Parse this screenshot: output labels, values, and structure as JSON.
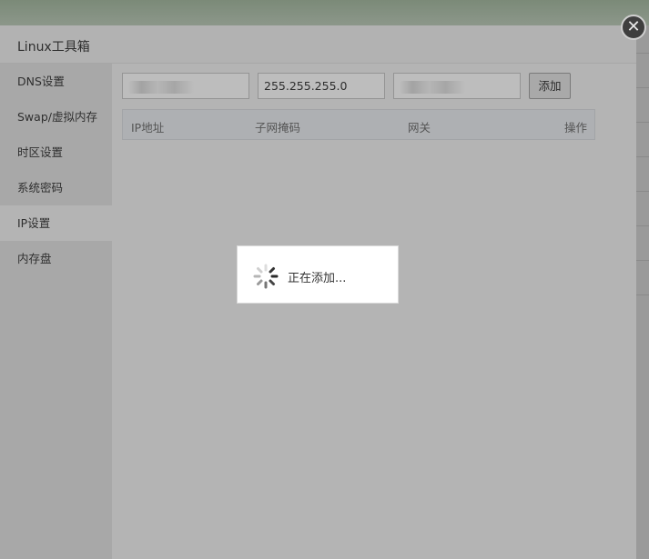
{
  "dialog": {
    "title": "Linux工具箱"
  },
  "sidebar": {
    "items": [
      {
        "label": "DNS设置"
      },
      {
        "label": "Swap/虚拟内存"
      },
      {
        "label": "时区设置"
      },
      {
        "label": "系统密码"
      },
      {
        "label": "IP设置",
        "active": true
      },
      {
        "label": "内存盘"
      }
    ]
  },
  "ip_form": {
    "ip_value": "",
    "netmask_value": "255.255.255.0",
    "gateway_value": "",
    "add_label": "添加"
  },
  "table": {
    "headers": [
      "IP地址",
      "子网掩码",
      "网关",
      "操作"
    ]
  },
  "loading": {
    "text": "正在添加..."
  },
  "colors": {
    "overlay": "#8a8d8a",
    "dialog_bg": "#b4b4b4",
    "sidebar_bg": "#a8a8a8",
    "popup_bg": "#ffffff"
  }
}
